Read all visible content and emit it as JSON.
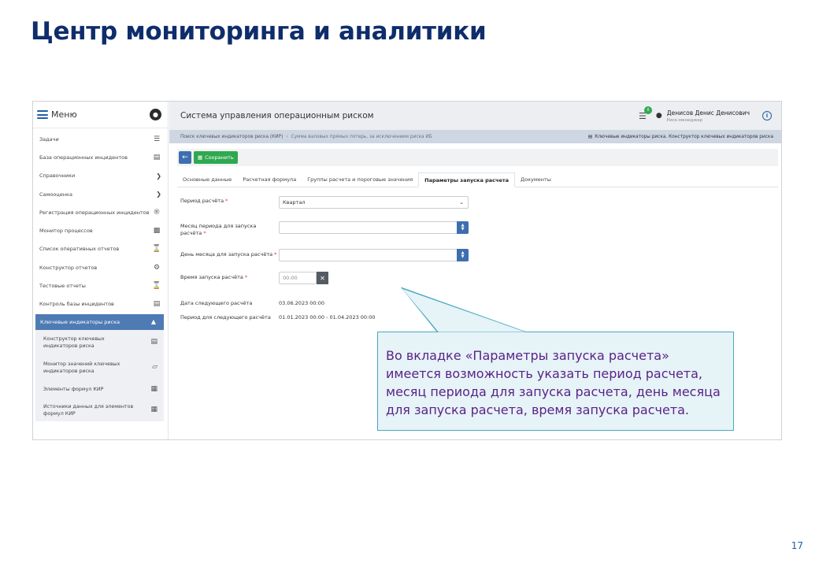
{
  "slide": {
    "title": "Центр мониторинга и аналитики",
    "page_number": "17"
  },
  "sidebar": {
    "menu_label": "Меню",
    "items": [
      {
        "label": "Задачи",
        "icon": "tasks-icon"
      },
      {
        "label": "База операционных инцидентов",
        "icon": "database-icon"
      },
      {
        "label": "Справочники",
        "icon": "chevron-down-icon"
      },
      {
        "label": "Самооценка",
        "icon": "chevron-down-icon"
      },
      {
        "label": "Регистрация операционных инцидентов",
        "icon": "registered-icon"
      },
      {
        "label": "Монитор процессов",
        "icon": "pulse-icon"
      },
      {
        "label": "Список оперативных отчетов",
        "icon": "hourglass-icon"
      },
      {
        "label": "Конструктор отчетов",
        "icon": "gears-icon"
      },
      {
        "label": "Тестовые отчеты",
        "icon": "hourglass-icon"
      },
      {
        "label": "Контроль базы инцидентов",
        "icon": "database-icon"
      }
    ],
    "active_group": {
      "label": "Ключевые индикаторы риска",
      "subitems": [
        {
          "label": "Конструктор ключевых индикаторов риска",
          "icon": "database-icon"
        },
        {
          "label": "Монитор значений ключевых индикаторов риска",
          "icon": "chart-icon"
        },
        {
          "label": "Элементы формул КИР",
          "icon": "document-icon"
        },
        {
          "label": "Источники данных для элементов формул КИР",
          "icon": "document-icon"
        }
      ]
    }
  },
  "topbar": {
    "title": "Система управления операционным риском",
    "notif_count": "0",
    "user_name": "Денисов Денис Денисович",
    "user_role": "Риск-менеджер"
  },
  "breadcrumb": {
    "first": "Поиск ключевых индикаторов риска (КИР)",
    "separator": "›",
    "current": "Сумма валовых прямых потерь, за исключением риска ИБ",
    "right": "Ключевые индикаторы риска. Конструктор ключевых индикаторов риска"
  },
  "toolbar": {
    "save_label": "Сохранить"
  },
  "tabs": [
    {
      "label": "Основные данные",
      "active": false
    },
    {
      "label": "Расчетная формула",
      "active": false
    },
    {
      "label": "Группы расчета и пороговые значения",
      "active": false
    },
    {
      "label": "Параметры запуска расчета",
      "active": true
    },
    {
      "label": "Документы",
      "active": false
    }
  ],
  "form": {
    "period_label": "Период расчёта",
    "period_value": "Квартал",
    "month_label": "Месяц периода для запуска расчёта",
    "month_value": "",
    "day_label": "День месяца для запуска расчёта",
    "day_value": "",
    "time_label": "Время запуска расчёта",
    "time_placeholder": "00:00",
    "next_date_label": "Дата следующего расчёта",
    "next_date_value": "03.06.2023 00:00",
    "next_period_label": "Период для следующего расчёта",
    "next_period_value": "01.01.2023 00:00 - 01.04.2023 00:00"
  },
  "callout": {
    "text": "Во вкладке «Параметры запуска расчета» имеется возможность указать период расчета, месяц периода для запуска расчета, день месяца для запуска расчета, время запуска расчета."
  }
}
